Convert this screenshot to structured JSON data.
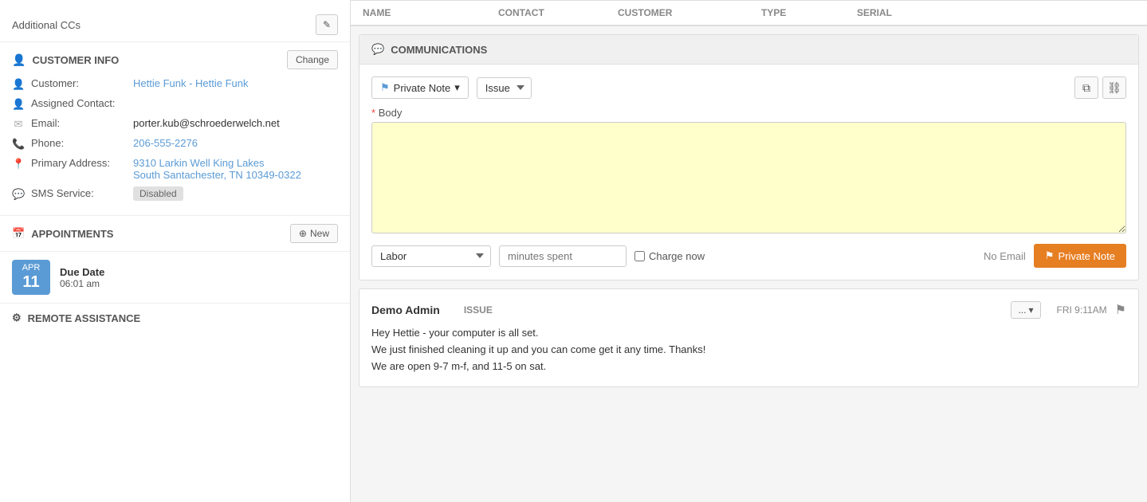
{
  "sidebar": {
    "additional_ccs_label": "Additional CCs",
    "edit_icon": "✎",
    "customer_info": {
      "section_title": "CUSTOMER INFO",
      "change_btn": "Change",
      "customer_label": "Customer:",
      "customer_value": "Hettie Funk - Hettie Funk",
      "assigned_contact_label": "Assigned Contact:",
      "email_label": "Email:",
      "email_value": "porter.kub@schroederwelch.net",
      "phone_label": "Phone:",
      "phone_value": "206-555-2276",
      "primary_address_label": "Primary Address:",
      "address_line1": "9310 Larkin Well King Lakes",
      "address_line2": "South Santachester, TN 10349-0322",
      "sms_service_label": "SMS Service:",
      "sms_service_value": "Disabled"
    },
    "appointments": {
      "section_title": "APPOINTMENTS",
      "new_btn": "+ New",
      "items": [
        {
          "month": "APR",
          "day": "11",
          "due_label": "Due Date",
          "time": "06:01 am"
        }
      ]
    },
    "remote_assistance": {
      "section_title": "REMOTE ASSISTANCE"
    }
  },
  "table_headers": {
    "name": "NAME",
    "contact": "CONTACT",
    "customer": "CUSTOMER",
    "type": "TYPE",
    "serial": "SERIAL"
  },
  "communications": {
    "section_title": "COMMUNICATIONS",
    "private_note_btn": "Private Note",
    "issue_option": "Issue",
    "copy_icon": "⧉",
    "link_icon": "🔗",
    "body_label": "* Body",
    "body_placeholder": "",
    "labor_option": "Labor",
    "minutes_placeholder": "minutes spent",
    "charge_now_label": "Charge now",
    "no_email_label": "No Email",
    "submit_btn": "Private Note"
  },
  "thread": {
    "author": "Demo Admin",
    "type": "ISSUE",
    "actions_btn": "...",
    "timestamp": "FRI 9:11AM",
    "messages": [
      "Hey Hettie - your computer is all set.",
      "We just finished cleaning it up and you can come get it any time. Thanks!",
      "We are open 9-7 m-f, and 11-5 on sat."
    ]
  }
}
